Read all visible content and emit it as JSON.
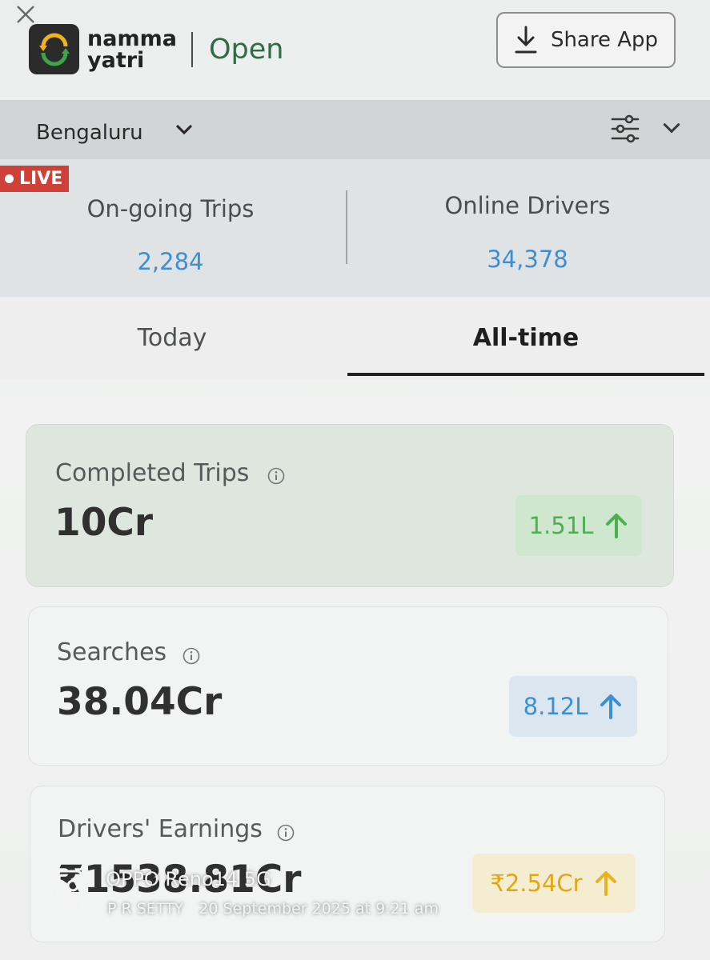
{
  "header": {
    "brand_line1": "namma",
    "brand_line2": "yatri",
    "brand_suffix": "Open",
    "share_label": "Share App"
  },
  "filter": {
    "city": "Bengaluru"
  },
  "live": {
    "badge": "LIVE",
    "ongoing_trips_label": "On-going Trips",
    "ongoing_trips_value": "2,284",
    "online_drivers_label": "Online Drivers",
    "online_drivers_value": "34,378"
  },
  "tabs": [
    {
      "label": "Today",
      "active": false
    },
    {
      "label": "All-time",
      "active": true
    }
  ],
  "metrics": [
    {
      "label": "Completed Trips",
      "value": "10Cr",
      "delta": "1.51L",
      "accent": "#4caf50"
    },
    {
      "label": "Searches",
      "value": "38.04Cr",
      "delta": "8.12L",
      "accent": "#3d8fd1"
    },
    {
      "label": "Drivers' Earnings",
      "value": "₹1538.81Cr",
      "delta": "₹2.54Cr",
      "accent": "#e8b21a"
    }
  ],
  "watermark": {
    "line1": "OPPO Reno14 5G",
    "author": "P R SETTY",
    "date": "20 September 2025 at 9:21 am"
  },
  "colors": {
    "brand_green": "#2f6b46",
    "live_red": "#cf4038",
    "stat_blue": "#3d8fd1"
  }
}
